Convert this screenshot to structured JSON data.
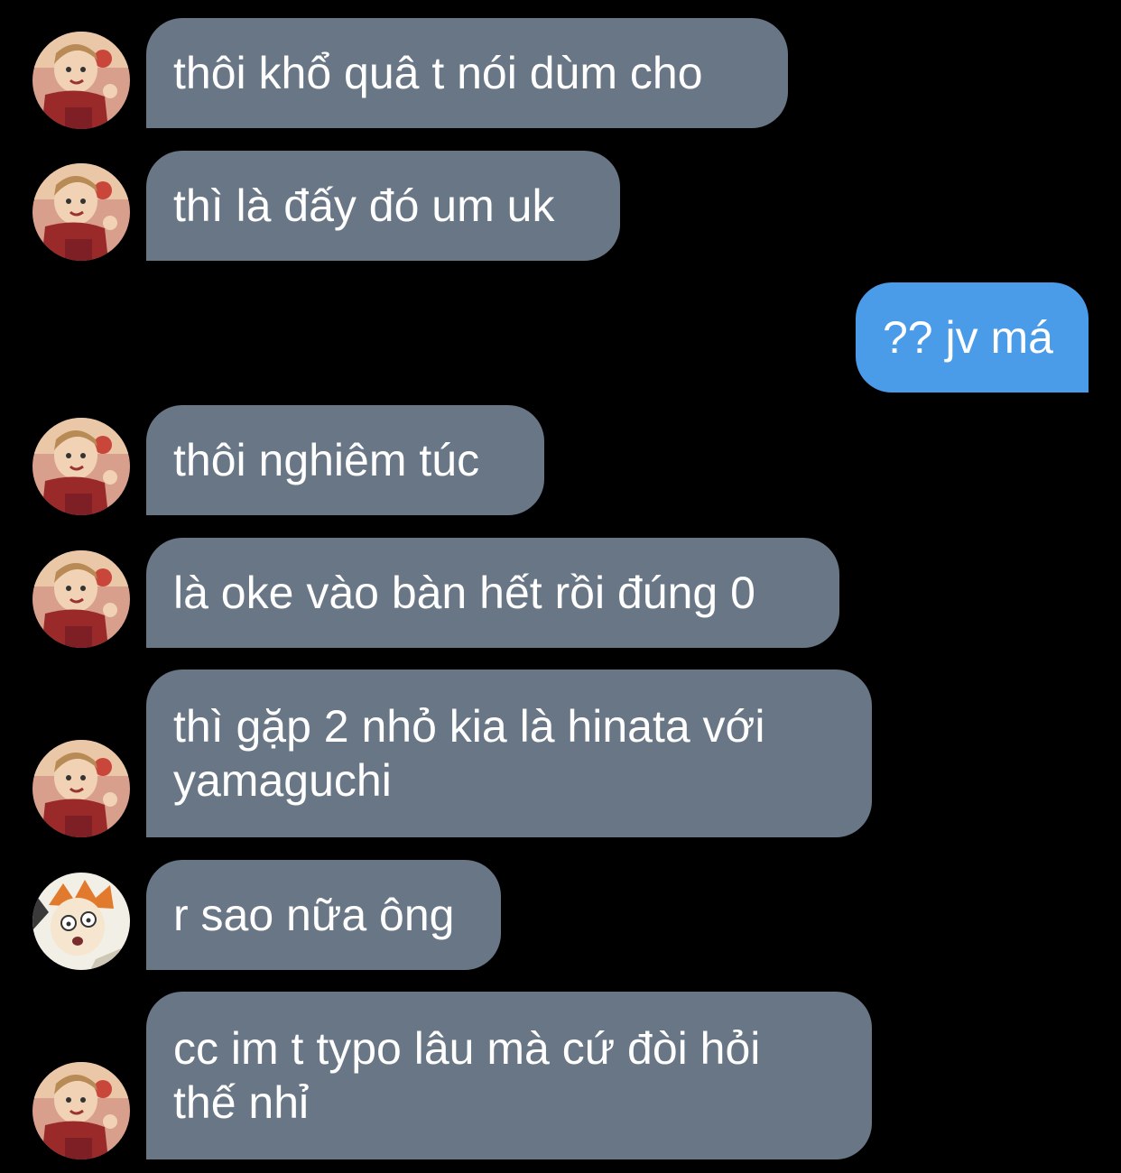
{
  "conversation": {
    "colors": {
      "background": "#000000",
      "incoming_bubble": "#687686",
      "outgoing_bubble": "#4a9be8",
      "text": "#ffffff"
    },
    "messages": [
      {
        "direction": "incoming",
        "avatar": "scarf-avatar-icon",
        "text": "thôi khổ quâ t nói dùm cho"
      },
      {
        "direction": "incoming",
        "avatar": "scarf-avatar-icon",
        "text": "thì là đấy đó um uk"
      },
      {
        "direction": "outgoing",
        "text": "?? jv má"
      },
      {
        "direction": "incoming",
        "avatar": "scarf-avatar-icon",
        "text": "thôi nghiêm túc"
      },
      {
        "direction": "incoming",
        "avatar": "scarf-avatar-icon",
        "text": "là oke vào bàn hết rồi đúng 0"
      },
      {
        "direction": "incoming",
        "avatar": "scarf-avatar-icon",
        "text": "thì gặp 2 nhỏ kia là hinata với\nyamaguchi"
      },
      {
        "direction": "incoming",
        "avatar": "orange-hair-avatar-icon",
        "text": "r sao nữa ông"
      },
      {
        "direction": "incoming",
        "avatar": "scarf-avatar-icon",
        "text": "cc im t typo lâu mà cứ đòi hỏi\nthế nhỉ"
      }
    ]
  }
}
